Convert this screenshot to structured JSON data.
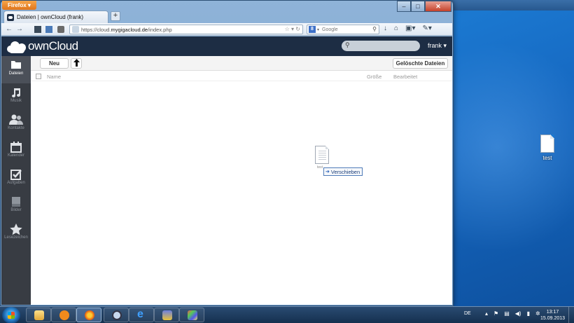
{
  "browser": {
    "app_button": "Firefox",
    "tab_title": "Dateien | ownCloud (frank)",
    "new_tab": "+",
    "url_prefix": "https://cloud.",
    "url_domain": "mygigacloud.de",
    "url_path": "/index.php",
    "search_placeholder": "Google",
    "win_min": "–",
    "win_max": "□",
    "win_close": "✕"
  },
  "owncloud": {
    "logo_text": "ownCloud",
    "user_menu": "frank ▾",
    "nav": [
      {
        "label": "Dateien",
        "icon": "folder-icon"
      },
      {
        "label": "Musik",
        "icon": "music-icon"
      },
      {
        "label": "Kontakte",
        "icon": "contacts-icon"
      },
      {
        "label": "Kalender",
        "icon": "calendar-icon"
      },
      {
        "label": "Aufgaben",
        "icon": "tasks-icon"
      },
      {
        "label": "Bilder",
        "icon": "pictures-icon"
      },
      {
        "label": "Lesezeichen",
        "icon": "bookmarks-icon"
      }
    ],
    "toolbar": {
      "new_label": "Neu",
      "deleted_files_label": "Gelöschte Dateien"
    },
    "table_headers": {
      "name": "Name",
      "size": "Größe",
      "modified": "Bearbeitet"
    },
    "drag": {
      "file_label": "test",
      "tooltip": "Verschieben"
    }
  },
  "desktop": {
    "file_label": "test"
  },
  "taskbar": {
    "language": "DE",
    "time": "13:17",
    "date": "15.09.2013"
  },
  "colors": {
    "oc_header": "#1d2d44",
    "oc_sidebar": "#383c43",
    "desktop": "#1b78d0",
    "firefox_button": "#e8861f"
  }
}
